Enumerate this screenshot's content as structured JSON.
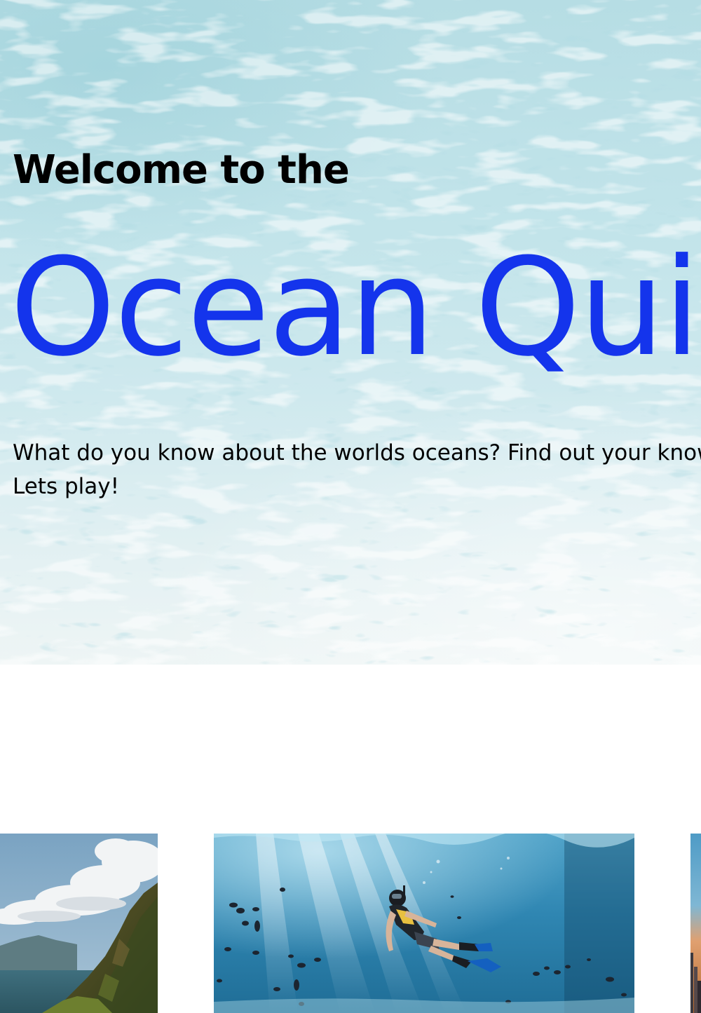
{
  "hero": {
    "welcome": "Welcome to the",
    "title": "Ocean Quiz",
    "intro_line1": "What do you know about the worlds oceans? Find out your knowledge!",
    "intro_line2": "Lets play!",
    "background": "shallow-water-texture",
    "colors": {
      "title": "#1434ec",
      "text": "#000000"
    }
  },
  "gallery": {
    "images": [
      {
        "subject": "coastal-cliffs-photo"
      },
      {
        "subject": "snorkeler-underwater-photo"
      },
      {
        "subject": "city-skyline-photo"
      }
    ]
  }
}
